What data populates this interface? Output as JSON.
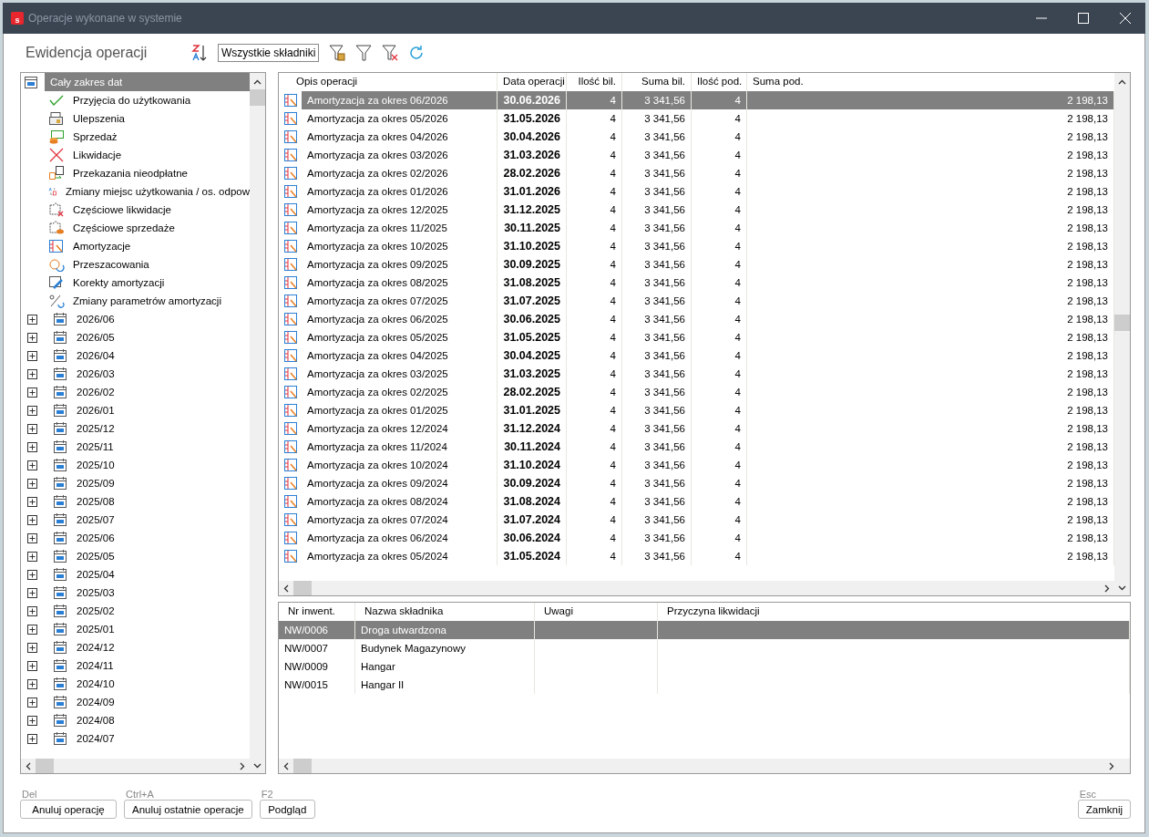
{
  "window": {
    "title": "Operacje wykonane w systemie",
    "icon_letter": "s"
  },
  "toolbar": {
    "title": "Ewidencja operacji",
    "filter_value": "Wszystkie składniki"
  },
  "tree": {
    "root": {
      "label": "Cały zakres dat",
      "selected": true
    },
    "categories": [
      {
        "label": "Przyjęcia do użytkowania",
        "kind": "check"
      },
      {
        "label": "Ulepszenia",
        "kind": "improve"
      },
      {
        "label": "Sprzedaż",
        "kind": "sale"
      },
      {
        "label": "Likwidacje",
        "kind": "liquidation"
      },
      {
        "label": "Przekazania nieodpłatne",
        "kind": "transfer"
      },
      {
        "label": "Zmiany miejsc użytkowania / os. odpow",
        "kind": "relocate"
      },
      {
        "label": "Częściowe likwidacje",
        "kind": "partial_liquidation"
      },
      {
        "label": "Częściowe sprzedaże",
        "kind": "partial_sale"
      },
      {
        "label": "Amortyzacje",
        "kind": "depreciation"
      },
      {
        "label": "Przeszacowania",
        "kind": "revaluation"
      },
      {
        "label": "Korekty amortyzacji",
        "kind": "correction"
      },
      {
        "label": "Zmiany parametrów amortyzacji",
        "kind": "parameters"
      }
    ],
    "periods": [
      {
        "label": "2026/06",
        "expanded": false
      },
      {
        "label": "2026/05",
        "expanded": false
      },
      {
        "label": "2026/04",
        "expanded": false
      },
      {
        "label": "2026/03",
        "expanded": false
      },
      {
        "label": "2026/02",
        "expanded": false
      },
      {
        "label": "2026/01",
        "expanded": false
      },
      {
        "label": "2025/12",
        "expanded": false
      },
      {
        "label": "2025/11",
        "expanded": false
      },
      {
        "label": "2025/10",
        "expanded": false
      },
      {
        "label": "2025/09",
        "expanded": false
      },
      {
        "label": "2025/08",
        "expanded": false
      },
      {
        "label": "2025/07",
        "expanded": false
      },
      {
        "label": "2025/06",
        "expanded": false
      },
      {
        "label": "2025/05",
        "expanded": false
      },
      {
        "label": "2025/04",
        "expanded": false
      },
      {
        "label": "2025/03",
        "expanded": false
      },
      {
        "label": "2025/02",
        "expanded": false
      },
      {
        "label": "2025/01",
        "expanded": false
      },
      {
        "label": "2024/12",
        "expanded": false
      },
      {
        "label": "2024/11",
        "expanded": false
      },
      {
        "label": "2024/10",
        "expanded": false
      },
      {
        "label": "2024/09",
        "expanded": false
      },
      {
        "label": "2024/08",
        "expanded": false
      },
      {
        "label": "2024/07",
        "expanded": false
      }
    ]
  },
  "operations": {
    "columns": [
      "Opis operacji",
      "Data operacji",
      "Ilość bil.",
      "Suma bil.",
      "Ilość pod.",
      "Suma pod."
    ],
    "rows": [
      {
        "description": "Amortyzacja za okres 06/2026",
        "date": "30.06.2026",
        "count_bil": "4",
        "sum_bil": "3 341,56",
        "count_pod": "4",
        "sum_pod": "2 198,13",
        "selected": true
      },
      {
        "description": "Amortyzacja za okres 05/2026",
        "date": "31.05.2026",
        "count_bil": "4",
        "sum_bil": "3 341,56",
        "count_pod": "4",
        "sum_pod": "2 198,13",
        "selected": false
      },
      {
        "description": "Amortyzacja za okres 04/2026",
        "date": "30.04.2026",
        "count_bil": "4",
        "sum_bil": "3 341,56",
        "count_pod": "4",
        "sum_pod": "2 198,13",
        "selected": false
      },
      {
        "description": "Amortyzacja za okres 03/2026",
        "date": "31.03.2026",
        "count_bil": "4",
        "sum_bil": "3 341,56",
        "count_pod": "4",
        "sum_pod": "2 198,13",
        "selected": false
      },
      {
        "description": "Amortyzacja za okres 02/2026",
        "date": "28.02.2026",
        "count_bil": "4",
        "sum_bil": "3 341,56",
        "count_pod": "4",
        "sum_pod": "2 198,13",
        "selected": false
      },
      {
        "description": "Amortyzacja za okres 01/2026",
        "date": "31.01.2026",
        "count_bil": "4",
        "sum_bil": "3 341,56",
        "count_pod": "4",
        "sum_pod": "2 198,13",
        "selected": false
      },
      {
        "description": "Amortyzacja za okres 12/2025",
        "date": "31.12.2025",
        "count_bil": "4",
        "sum_bil": "3 341,56",
        "count_pod": "4",
        "sum_pod": "2 198,13",
        "selected": false
      },
      {
        "description": "Amortyzacja za okres 11/2025",
        "date": "30.11.2025",
        "count_bil": "4",
        "sum_bil": "3 341,56",
        "count_pod": "4",
        "sum_pod": "2 198,13",
        "selected": false
      },
      {
        "description": "Amortyzacja za okres 10/2025",
        "date": "31.10.2025",
        "count_bil": "4",
        "sum_bil": "3 341,56",
        "count_pod": "4",
        "sum_pod": "2 198,13",
        "selected": false
      },
      {
        "description": "Amortyzacja za okres 09/2025",
        "date": "30.09.2025",
        "count_bil": "4",
        "sum_bil": "3 341,56",
        "count_pod": "4",
        "sum_pod": "2 198,13",
        "selected": false
      },
      {
        "description": "Amortyzacja za okres 08/2025",
        "date": "31.08.2025",
        "count_bil": "4",
        "sum_bil": "3 341,56",
        "count_pod": "4",
        "sum_pod": "2 198,13",
        "selected": false
      },
      {
        "description": "Amortyzacja za okres 07/2025",
        "date": "31.07.2025",
        "count_bil": "4",
        "sum_bil": "3 341,56",
        "count_pod": "4",
        "sum_pod": "2 198,13",
        "selected": false
      },
      {
        "description": "Amortyzacja za okres 06/2025",
        "date": "30.06.2025",
        "count_bil": "4",
        "sum_bil": "3 341,56",
        "count_pod": "4",
        "sum_pod": "2 198,13",
        "selected": false
      },
      {
        "description": "Amortyzacja za okres 05/2025",
        "date": "31.05.2025",
        "count_bil": "4",
        "sum_bil": "3 341,56",
        "count_pod": "4",
        "sum_pod": "2 198,13",
        "selected": false
      },
      {
        "description": "Amortyzacja za okres 04/2025",
        "date": "30.04.2025",
        "count_bil": "4",
        "sum_bil": "3 341,56",
        "count_pod": "4",
        "sum_pod": "2 198,13",
        "selected": false
      },
      {
        "description": "Amortyzacja za okres 03/2025",
        "date": "31.03.2025",
        "count_bil": "4",
        "sum_bil": "3 341,56",
        "count_pod": "4",
        "sum_pod": "2 198,13",
        "selected": false
      },
      {
        "description": "Amortyzacja za okres 02/2025",
        "date": "28.02.2025",
        "count_bil": "4",
        "sum_bil": "3 341,56",
        "count_pod": "4",
        "sum_pod": "2 198,13",
        "selected": false
      },
      {
        "description": "Amortyzacja za okres 01/2025",
        "date": "31.01.2025",
        "count_bil": "4",
        "sum_bil": "3 341,56",
        "count_pod": "4",
        "sum_pod": "2 198,13",
        "selected": false
      },
      {
        "description": "Amortyzacja za okres 12/2024",
        "date": "31.12.2024",
        "count_bil": "4",
        "sum_bil": "3 341,56",
        "count_pod": "4",
        "sum_pod": "2 198,13",
        "selected": false
      },
      {
        "description": "Amortyzacja za okres 11/2024",
        "date": "30.11.2024",
        "count_bil": "4",
        "sum_bil": "3 341,56",
        "count_pod": "4",
        "sum_pod": "2 198,13",
        "selected": false
      },
      {
        "description": "Amortyzacja za okres 10/2024",
        "date": "31.10.2024",
        "count_bil": "4",
        "sum_bil": "3 341,56",
        "count_pod": "4",
        "sum_pod": "2 198,13",
        "selected": false
      },
      {
        "description": "Amortyzacja za okres 09/2024",
        "date": "30.09.2024",
        "count_bil": "4",
        "sum_bil": "3 341,56",
        "count_pod": "4",
        "sum_pod": "2 198,13",
        "selected": false
      },
      {
        "description": "Amortyzacja za okres 08/2024",
        "date": "31.08.2024",
        "count_bil": "4",
        "sum_bil": "3 341,56",
        "count_pod": "4",
        "sum_pod": "2 198,13",
        "selected": false
      },
      {
        "description": "Amortyzacja za okres 07/2024",
        "date": "31.07.2024",
        "count_bil": "4",
        "sum_bil": "3 341,56",
        "count_pod": "4",
        "sum_pod": "2 198,13",
        "selected": false
      },
      {
        "description": "Amortyzacja za okres 06/2024",
        "date": "30.06.2024",
        "count_bil": "4",
        "sum_bil": "3 341,56",
        "count_pod": "4",
        "sum_pod": "2 198,13",
        "selected": false
      },
      {
        "description": "Amortyzacja za okres 05/2024",
        "date": "31.05.2024",
        "count_bil": "4",
        "sum_bil": "3 341,56",
        "count_pod": "4",
        "sum_pod": "2 198,13",
        "selected": false
      }
    ]
  },
  "assets": {
    "columns": [
      "Nr inwent.",
      "Nazwa składnika",
      "Uwagi",
      "Przyczyna likwidacji"
    ],
    "rows": [
      {
        "number": "NW/0006",
        "name": "Droga utwardzona",
        "selected": true
      },
      {
        "number": "NW/0007",
        "name": "Budynek Magazynowy",
        "selected": false
      },
      {
        "number": "NW/0009",
        "name": "Hangar",
        "selected": false
      },
      {
        "number": "NW/0015",
        "name": "Hangar II",
        "selected": false
      }
    ]
  },
  "buttons": [
    {
      "shortcut": "Del",
      "label": "Anuluj operację"
    },
    {
      "shortcut": "Ctrl+A",
      "label": "Anuluj ostatnie operacje"
    },
    {
      "shortcut": "F2",
      "label": "Podgląd"
    }
  ],
  "close_button": {
    "shortcut": "Esc",
    "label": "Zamknij"
  }
}
